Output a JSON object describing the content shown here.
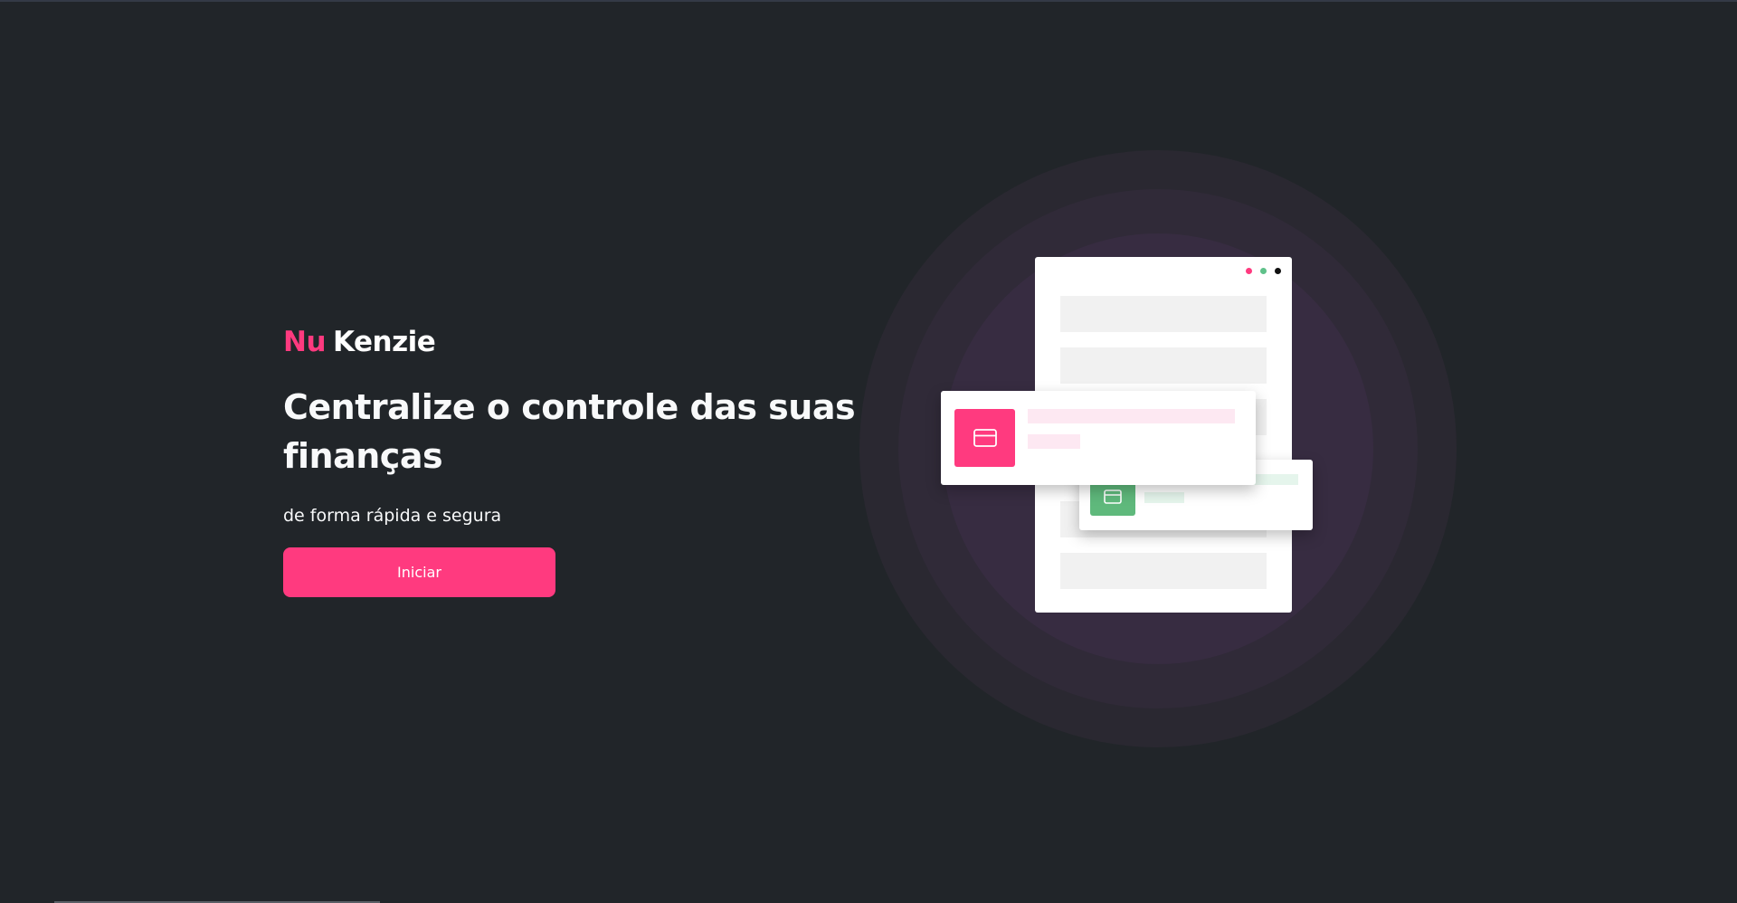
{
  "brand": {
    "accent_part": "Nu",
    "main_part": "Kenzie",
    "accent_color": "#ff3a7f"
  },
  "hero": {
    "headline": "Centralize o controle das suas finanças",
    "subtitle": "de forma rápida e segura",
    "cta_label": "Iniciar"
  },
  "illustration": {
    "window_dots": [
      "pink",
      "green",
      "black"
    ],
    "icons": [
      "card-icon",
      "card-icon"
    ]
  },
  "colors": {
    "background": "#212529",
    "primary": "#ff3a7f",
    "success": "#5fb97c",
    "text": "#f8f9fa"
  }
}
